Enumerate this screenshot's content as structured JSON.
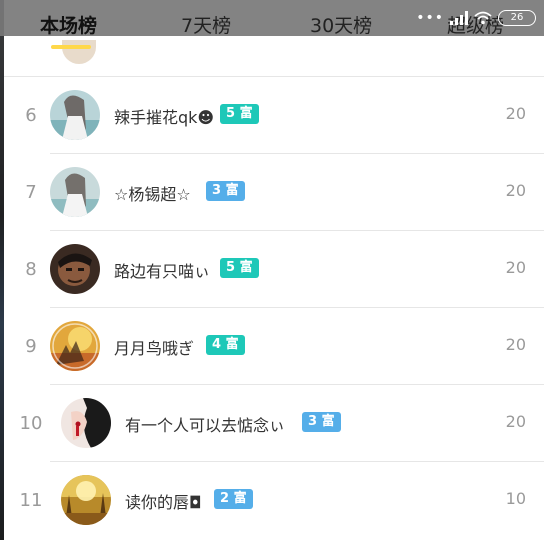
{
  "tabs": [
    {
      "label": "本场榜"
    },
    {
      "label": "7天榜"
    },
    {
      "label": "30天榜"
    },
    {
      "label": "超级榜"
    }
  ],
  "status": {
    "battery": "26"
  },
  "colors": {
    "badge_teal": "#1ec8b8",
    "badge_blue": "#55aee9",
    "tab_accent": "#ffd84a"
  },
  "rows": [
    {
      "rank": "6",
      "name": "辣手摧花qk☻",
      "badge": "5 富",
      "score": "20"
    },
    {
      "rank": "7",
      "name": "☆杨锡超☆",
      "badge": "3 富",
      "score": "20"
    },
    {
      "rank": "8",
      "name": "路边有只喵ぃ",
      "badge": "5 富",
      "score": "20"
    },
    {
      "rank": "9",
      "name": "月月鸟哦ぎ",
      "badge": "4 富",
      "score": "20"
    },
    {
      "rank": "10",
      "name": "有一个人可以去惦念ぃ",
      "badge": "3 富",
      "score": "20"
    },
    {
      "rank": "11",
      "name": "读你的唇◘",
      "badge": "2 富",
      "score": "10"
    }
  ]
}
